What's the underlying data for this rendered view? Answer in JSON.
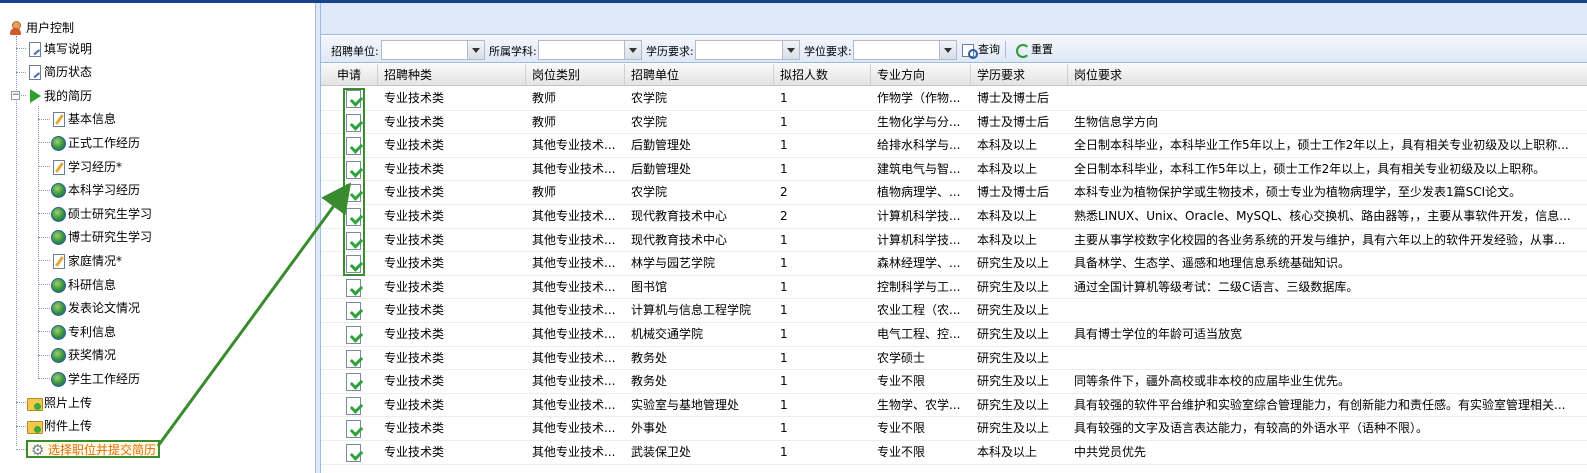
{
  "tree": {
    "root": "用户控制",
    "items": [
      {
        "label": "填写说明",
        "icon": "page-edit-icon"
      },
      {
        "label": "简历状态",
        "icon": "page-edit-icon"
      },
      {
        "label": "我的简历",
        "icon": "play-icon"
      }
    ],
    "resume_children": [
      {
        "label": "基本信息",
        "icon": "pencil-icon"
      },
      {
        "label": "正式工作经历",
        "icon": "globe-icon"
      },
      {
        "label": "学习经历*",
        "icon": "pencil-icon"
      },
      {
        "label": "本科学习经历",
        "icon": "globe-icon"
      },
      {
        "label": "硕士研究生学习",
        "icon": "globe-icon"
      },
      {
        "label": "博士研究生学习",
        "icon": "globe-icon"
      },
      {
        "label": "家庭情况*",
        "icon": "pencil-icon"
      },
      {
        "label": "科研信息",
        "icon": "globe-icon"
      },
      {
        "label": "发表论文情况",
        "icon": "globe-icon"
      },
      {
        "label": "专利信息",
        "icon": "globe-icon"
      },
      {
        "label": "获奖情况",
        "icon": "globe-icon"
      },
      {
        "label": "学生工作经历",
        "icon": "globe-icon"
      }
    ],
    "bottom_items": [
      {
        "label": "照片上传",
        "icon": "folder-add-icon"
      },
      {
        "label": "附件上传",
        "icon": "folder-add-icon"
      },
      {
        "label": "选择职位并提交简历",
        "icon": "gear-icon"
      }
    ]
  },
  "toolbar": {
    "unit_label": "招聘单位:",
    "unit_value": "",
    "subject_label": "所属学科:",
    "subject_value": "",
    "education_label": "学历要求:",
    "education_value": "",
    "degree_label": "学位要求:",
    "degree_value": "",
    "query_label": "查询",
    "reset_label": "重置"
  },
  "grid": {
    "columns": [
      "申请",
      "招聘种类",
      "岗位类别",
      "招聘单位",
      "拟招人数",
      "专业方向",
      "学历要求",
      "岗位要求"
    ],
    "rows": [
      [
        "",
        "专业技术类",
        "教师",
        "农学院",
        "1",
        "作物学（作物...",
        "博士及博士后",
        ""
      ],
      [
        "",
        "专业技术类",
        "教师",
        "农学院",
        "1",
        "生物化学与分...",
        "博士及博士后",
        "生物信息学方向"
      ],
      [
        "",
        "专业技术类",
        "其他专业技术...",
        "后勤管理处",
        "1",
        "给排水科学与...",
        "本科及以上",
        "全日制本科毕业，本科毕业工作5年以上，硕士工作2年以上，具有相关专业初级及以上职称..."
      ],
      [
        "",
        "专业技术类",
        "其他专业技术...",
        "后勤管理处",
        "1",
        "建筑电气与智...",
        "本科及以上",
        "全日制本科毕业，本科工作5年以上，硕士工作2年以上，具有相关专业初级及以上职称。"
      ],
      [
        "",
        "专业技术类",
        "教师",
        "农学院",
        "2",
        "植物病理学、...",
        "博士及博士后",
        "本科专业为植物保护学或生物技术，硕士专业为植物病理学，至少发表1篇SCI论文。"
      ],
      [
        "",
        "专业技术类",
        "其他专业技术...",
        "现代教育技术中心",
        "2",
        "计算机科学技...",
        "本科及以上",
        "熟悉LINUX、Unix、Oracle、MySQL、核心交换机、路由器等，，主要从事软件开发，信息..."
      ],
      [
        "",
        "专业技术类",
        "其他专业技术...",
        "现代教育技术中心",
        "1",
        "计算机科学技...",
        "本科及以上",
        "主要从事学校数字化校园的各业务系统的开发与维护，具有六年以上的软件开发经验，从事..."
      ],
      [
        "",
        "专业技术类",
        "其他专业技术...",
        "林学与园艺学院",
        "1",
        "森林经理学、...",
        "研究生及以上",
        "具备林学、生态学、遥感和地理信息系统基础知识。"
      ],
      [
        "",
        "专业技术类",
        "其他专业技术...",
        "图书馆",
        "1",
        "控制科学与工...",
        "研究生及以上",
        "通过全国计算机等级考试：二级C语言、三级数据库。"
      ],
      [
        "",
        "专业技术类",
        "其他专业技术...",
        "计算机与信息工程学院",
        "1",
        "农业工程（农...",
        "研究生及以上",
        ""
      ],
      [
        "",
        "专业技术类",
        "其他专业技术...",
        "机械交通学院",
        "1",
        "电气工程、控...",
        "研究生及以上",
        "具有博士学位的年龄可适当放宽"
      ],
      [
        "",
        "专业技术类",
        "其他专业技术...",
        "教务处",
        "1",
        "农学硕士",
        "研究生及以上",
        ""
      ],
      [
        "",
        "专业技术类",
        "其他专业技术...",
        "教务处",
        "1",
        "专业不限",
        "研究生及以上",
        "同等条件下，疆外高校或非本校的应届毕业生优先。"
      ],
      [
        "",
        "专业技术类",
        "其他专业技术...",
        "实验室与基地管理处",
        "1",
        "生物学、农学...",
        "研究生及以上",
        "具有较强的软件平台维护和实验室综合管理能力，有创新能力和责任感。有实验室管理相关..."
      ],
      [
        "",
        "专业技术类",
        "其他专业技术...",
        "外事处",
        "1",
        "专业不限",
        "研究生及以上",
        "具有较强的文字及语言表达能力，有较高的外语水平（语种不限）。"
      ],
      [
        "",
        "专业技术类",
        "其他专业技术...",
        "武装保卫处",
        "1",
        "专业不限",
        "本科及以上",
        "中共党员优先"
      ]
    ]
  },
  "colors": {
    "highlight_green": "#3a8a2e",
    "selected_text": "#e46b00",
    "panel_blue": "#dfe8f6",
    "border_blue": "#99bbe8"
  }
}
